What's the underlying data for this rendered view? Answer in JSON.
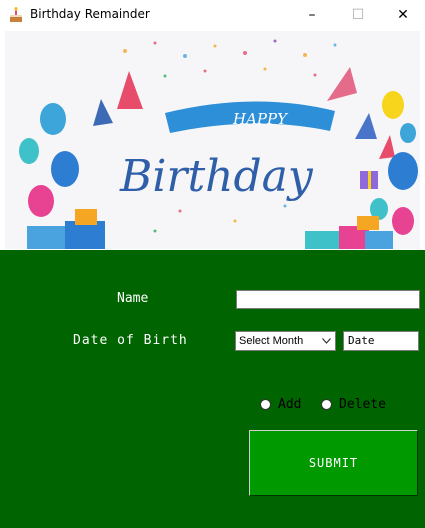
{
  "window": {
    "title": "Birthday Remainder",
    "icon": "cake-icon",
    "controls": {
      "minimize": "–",
      "maximize": "☐",
      "close": "✕"
    }
  },
  "banner": {
    "happy_text": "HAPPY",
    "birthday_text": "Birthday"
  },
  "form": {
    "background_color": "#006400",
    "name_label": "Name",
    "name_value": "",
    "dob_label": "Date of Birth",
    "month_select": {
      "selected": "Select Month"
    },
    "date_value": "Date",
    "radio_add_label": "Add",
    "radio_delete_label": "Delete",
    "submit_label": "SUBMIT"
  }
}
